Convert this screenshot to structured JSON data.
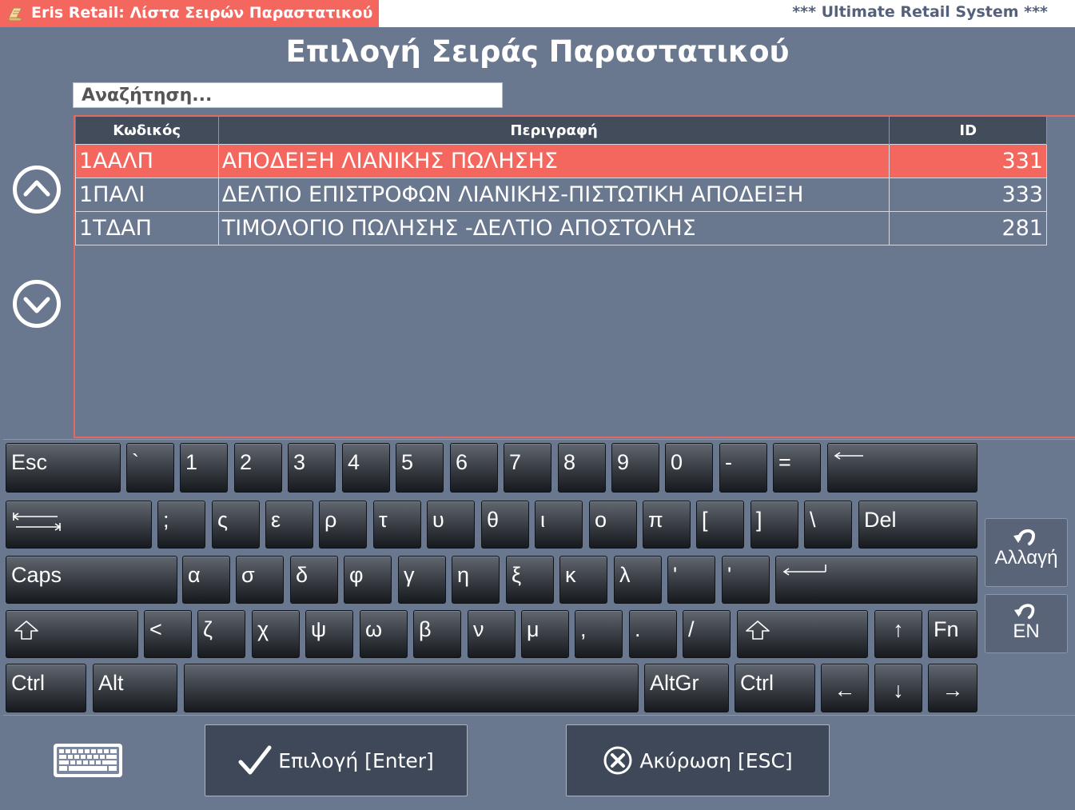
{
  "window": {
    "title": "Eris Retail: Λίστα Σειρών Παραστατικού",
    "tagline": "*** Ultimate Retail System ***"
  },
  "heading": "Επιλογή Σειράς Παραστατικού",
  "search": {
    "placeholder": "Αναζήτηση..."
  },
  "grid": {
    "columns": [
      "Κωδικός",
      "Περιγραφή",
      "ID"
    ],
    "rows": [
      {
        "code": "1ΑΑΛΠ",
        "description": "ΑΠΟΔΕΙΞΗ ΛΙΑΝΙΚΗΣ ΠΩΛΗΣΗΣ",
        "id": "331",
        "selected": true
      },
      {
        "code": "1ΠΑΛΙ",
        "description": "ΔΕΛΤΙΟ ΕΠΙΣΤΡΟΦΩΝ ΛΙΑΝΙΚΗΣ-ΠΙΣΤΩΤΙΚΗ ΑΠΟΔΕΙΞΗ",
        "id": "333",
        "selected": false
      },
      {
        "code": "1ΤΔΑΠ",
        "description": "ΤΙΜΟΛΟΓΙΟ ΠΩΛΗΣΗΣ -ΔΕΛΤΙΟ ΑΠΟΣΤΟΛΗΣ",
        "id": "281",
        "selected": false
      }
    ]
  },
  "nav": {
    "up_icon": "chevron-up-circle-icon",
    "down_icon": "chevron-down-circle-icon"
  },
  "keyboard": {
    "row1": [
      "Esc",
      "`",
      "1",
      "2",
      "3",
      "4",
      "5",
      "6",
      "7",
      "8",
      "9",
      "0",
      "-",
      "="
    ],
    "row2": [
      ";",
      "ς",
      "ε",
      "ρ",
      "τ",
      "υ",
      "θ",
      "ι",
      "ο",
      "π",
      "[",
      "]",
      "\\",
      "Del"
    ],
    "row3": [
      "Caps",
      "α",
      "σ",
      "δ",
      "φ",
      "γ",
      "η",
      "ξ",
      "κ",
      "λ",
      "'",
      "'"
    ],
    "row4": [
      "<",
      "ζ",
      "χ",
      "ψ",
      "ω",
      "β",
      "ν",
      "μ",
      ",",
      ".",
      "/",
      "Fn"
    ],
    "row5": [
      "Ctrl",
      "Alt",
      "AltGr",
      "Ctrl"
    ],
    "arrows": {
      "up": "↑",
      "down": "↓",
      "left": "←",
      "right": "→"
    },
    "change_label": "Αλλαγή",
    "lang_label": "EN"
  },
  "buttons": {
    "select": "Επιλογή [Enter]",
    "cancel": "Ακύρωση [ESC]"
  },
  "colors": {
    "accent": "#f4675f",
    "panel": "#69778f",
    "header": "#434c5a"
  }
}
